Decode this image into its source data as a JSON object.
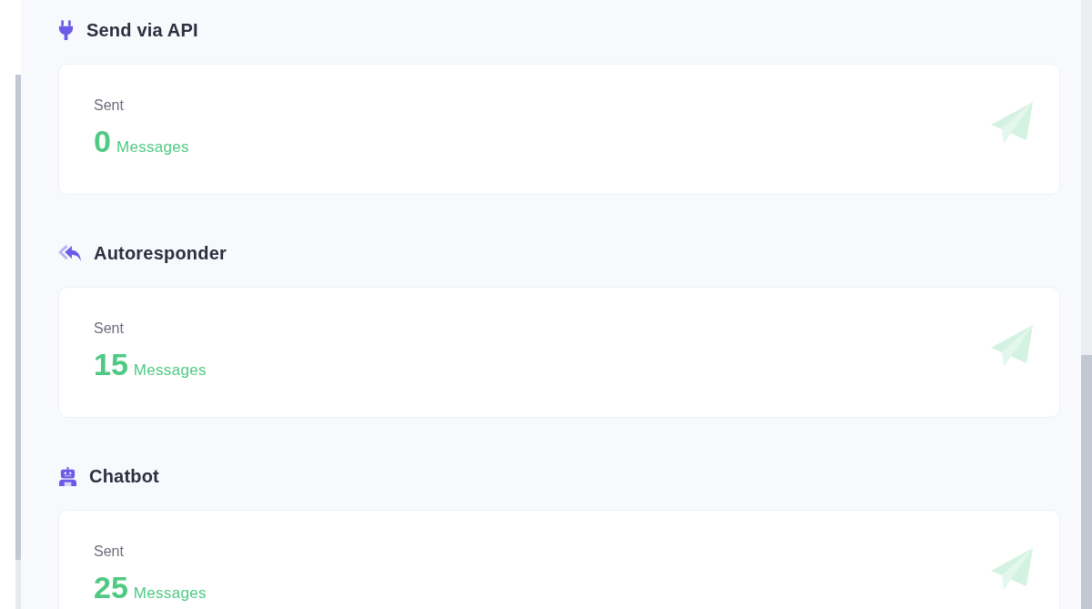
{
  "sections": [
    {
      "kind": "api",
      "title": "Send via API",
      "stat": {
        "label": "Sent",
        "count": "0",
        "unit": "Messages"
      }
    },
    {
      "kind": "autoresponder",
      "title": "Autoresponder",
      "stat": {
        "label": "Sent",
        "count": "15",
        "unit": "Messages"
      }
    },
    {
      "kind": "chatbot",
      "title": "Chatbot",
      "stat": {
        "label": "Sent",
        "count": "25",
        "unit": "Messages"
      }
    }
  ]
}
